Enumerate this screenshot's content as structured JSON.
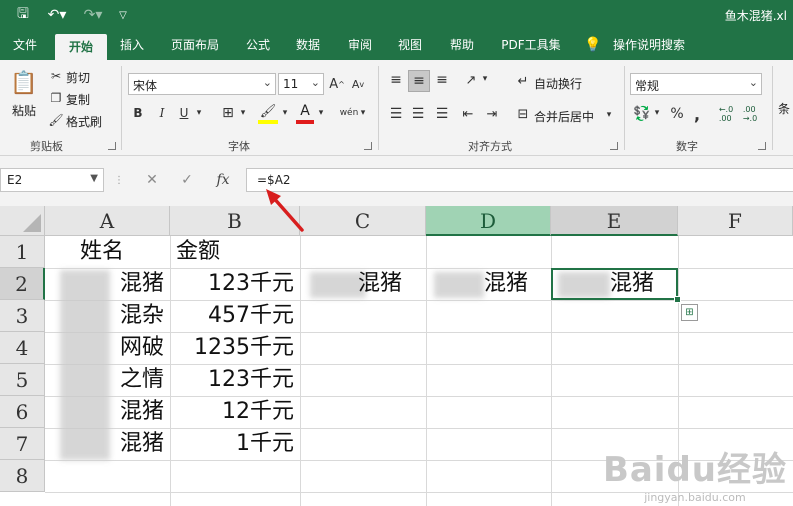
{
  "title_bar": {
    "doc_name": "鱼木混猪.xl",
    "save_icon": "save-icon",
    "undo_icon": "undo-icon",
    "redo_icon": "redo-icon",
    "customize_icon": "chevron-down-icon",
    "bg_color": "#217346"
  },
  "tabs": [
    {
      "label": "文件",
      "active": false
    },
    {
      "label": "开始",
      "active": true
    },
    {
      "label": "插入",
      "active": false
    },
    {
      "label": "页面布局",
      "active": false
    },
    {
      "label": "公式",
      "active": false
    },
    {
      "label": "数据",
      "active": false
    },
    {
      "label": "审阅",
      "active": false
    },
    {
      "label": "视图",
      "active": false
    },
    {
      "label": "帮助",
      "active": false
    },
    {
      "label": "PDF工具集",
      "active": false
    },
    {
      "label": "操作说明搜索",
      "active": false
    }
  ],
  "ribbon": {
    "clipboard": {
      "paste": "粘贴",
      "cut": "剪切",
      "copy": "复制",
      "format_painter": "格式刷",
      "group_label": "剪贴板"
    },
    "font": {
      "font_name": "宋体",
      "font_size": "11",
      "grow": "A",
      "shrink": "A",
      "bold": "B",
      "italic": "I",
      "underline": "U",
      "font_color_letter": "A",
      "phonetic": "wén",
      "group_label": "字体"
    },
    "alignment": {
      "wrap_text": "自动换行",
      "merge_center": "合并后居中",
      "group_label": "对齐方式"
    },
    "number": {
      "format": "常规",
      "percent": "%",
      "comma": ",",
      "inc_decimal": "←.0\n.00",
      "dec_decimal": ".00\n→.0",
      "group_label": "数字"
    },
    "next_group_label": "条"
  },
  "formula_bar": {
    "name_box": "E2",
    "cancel": "✕",
    "enter": "✓",
    "fx": "fx",
    "formula": "=$A2"
  },
  "sheet": {
    "columns": [
      "A",
      "B",
      "C",
      "D",
      "E",
      "F"
    ],
    "selected_column": "D",
    "current_column": "E",
    "rows": [
      "1",
      "2",
      "3",
      "4",
      "5",
      "6",
      "7",
      "8"
    ],
    "current_row": "2",
    "cells": {
      "A1": "姓名",
      "B1": "金额",
      "A2": "混猪",
      "B2": "123千元",
      "C2": "混猪",
      "D2": "混猪",
      "E2": "混猪",
      "A3": "混杂",
      "B3": "457千元",
      "A4": "网破",
      "B4": "1235千元",
      "A5": "之情",
      "B5": "123千元",
      "A6": "混猪",
      "B6": "12千元",
      "A7": "混猪",
      "B7": "1千元"
    },
    "accent_color": "#217346",
    "selected_header_color": "#a0d3b4"
  },
  "watermark": {
    "brand": "Baidu经验",
    "url": "jingyan.baidu.com"
  }
}
